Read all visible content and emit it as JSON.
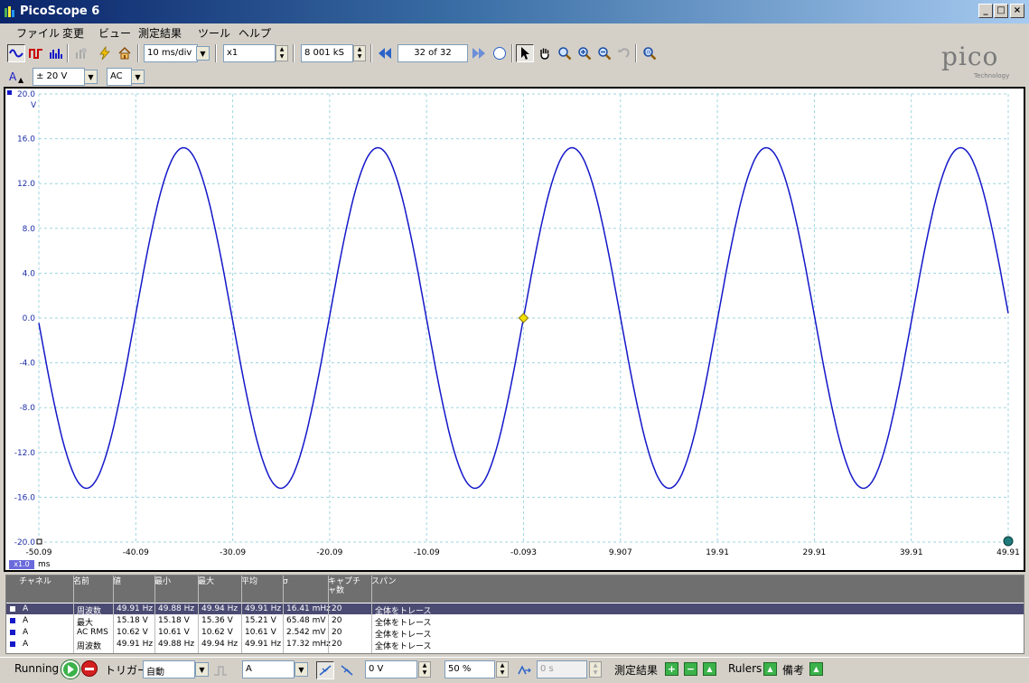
{
  "window": {
    "title": "PicoScope 6",
    "controls": [
      "_",
      "□",
      "×"
    ]
  },
  "menu": [
    "ファイル",
    "変更",
    "ビュー",
    "測定結果",
    "ツール",
    "ヘルプ"
  ],
  "toolbar": {
    "timebase": "10 ms/div",
    "zoom": "x1",
    "samples": "8 001 kS",
    "buffer": "32 of 32"
  },
  "channel": {
    "name": "A",
    "range": "± 20 V",
    "coupling": "AC"
  },
  "branding": {
    "logo": "pico",
    "sub": "Technology"
  },
  "chart_data": {
    "type": "line",
    "y_unit": "V",
    "x_unit": "ms",
    "x_scale_label": "x1.0",
    "ylim": [
      -20,
      20
    ],
    "xlim": [
      -50.09,
      49.91
    ],
    "y_ticks": [
      "20.0",
      "16.0",
      "12.0",
      "8.0",
      "4.0",
      "0.0",
      "-4.0",
      "-8.0",
      "-12.0",
      "-16.0",
      "-20.0"
    ],
    "x_ticks": [
      "-50.09",
      "-40.09",
      "-30.09",
      "-20.09",
      "-10.09",
      "-0.093",
      "9.907",
      "19.91",
      "29.91",
      "39.91",
      "49.91"
    ],
    "grid": true,
    "series": [
      {
        "color": "#1418c8",
        "waveform": "sine",
        "amplitude": 15.2,
        "frequency_hz": 49.91,
        "zero_crossing_ms": -0.093
      }
    ],
    "trigger_marker": {
      "x": -0.093,
      "y": 0.0,
      "color": "#f4e000"
    }
  },
  "measurements": {
    "headers": [
      "チャネル",
      "名前",
      "値",
      "最小",
      "最大",
      "平均",
      "σ",
      "キャプチャ数",
      "スパン"
    ],
    "rows": [
      [
        "A",
        "周波数",
        "49.91 Hz",
        "49.88 Hz",
        "49.94 Hz",
        "49.91 Hz",
        "16.41 mHz",
        "20",
        "全体をトレース"
      ],
      [
        "A",
        "最大",
        "15.18 V",
        "15.18 V",
        "15.36 V",
        "15.21 V",
        "65.48 mV",
        "20",
        "全体をトレース"
      ],
      [
        "A",
        "AC RMS",
        "10.62 V",
        "10.61 V",
        "10.62 V",
        "10.61 V",
        "2.542 mV",
        "20",
        "全体をトレース"
      ],
      [
        "A",
        "周波数",
        "49.91 Hz",
        "49.88 Hz",
        "49.94 Hz",
        "49.91 Hz",
        "17.32 mHz",
        "20",
        "全体をトレース"
      ]
    ]
  },
  "status": {
    "running": "Running",
    "trigger_label": "トリガー",
    "trigger_mode": "自動",
    "trigger_channel": "A",
    "trigger_level": "0 V",
    "pretrigger": "50 %",
    "delay": "0 s",
    "measurements_label": "測定結果",
    "rulers_label": "Rulers",
    "notes_label": "備考"
  }
}
